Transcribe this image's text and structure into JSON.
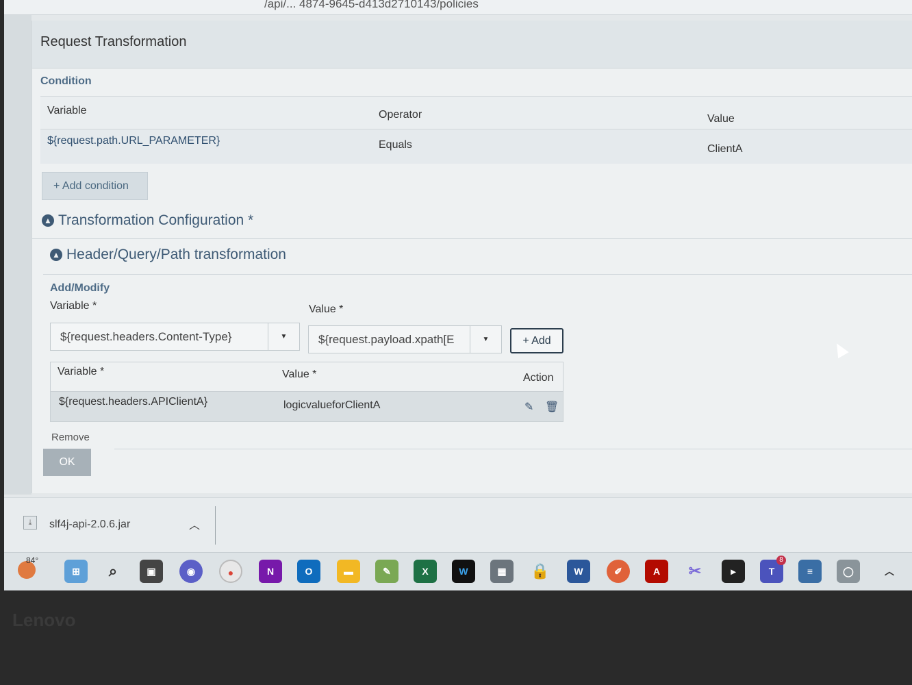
{
  "browser": {
    "url_fragment": "/api/... 4874-9645-d413d2710143/policies"
  },
  "modal": {
    "title": "Request Transformation",
    "condition": {
      "section_label": "Condition",
      "headers": [
        "Variable",
        "Operator",
        "Value"
      ],
      "row": {
        "variable": "${request.path.URL_PARAMETER}",
        "operator": "Equals",
        "value": "ClientA"
      },
      "add_condition_label": "+  Add condition"
    },
    "transformation_configuration_label": "Transformation Configuration *",
    "header_query_path_label": "Header/Query/Path transformation",
    "add_modify": {
      "section_label": "Add/Modify",
      "variable_label": "Variable *",
      "value_label": "Value *",
      "variable_select_value": "${request.headers.Content-Type}",
      "value_select_value": "${request.payload.xpath[E",
      "add_button_label": "+  Add"
    },
    "entries_table": {
      "headers": [
        "Variable *",
        "Value *",
        "Action"
      ],
      "rows": [
        {
          "variable": "${request.headers.APIClientA}",
          "value": "logicvalueforClientA"
        }
      ]
    },
    "remove_label": "Remove",
    "ok_button_label": "OK"
  },
  "download_bar": {
    "file_name": "slf4j-api-2.0.6.jar"
  },
  "taskbar": {
    "temperature": "84°",
    "teams_badge": "8",
    "icons": [
      "start-icon",
      "search-icon",
      "task-view-icon",
      "chat-icon",
      "chrome-icon",
      "onenote-icon",
      "outlook-icon",
      "file-explorer-icon",
      "notepad-plus-icon",
      "excel-icon",
      "webex-icon",
      "calculator-icon",
      "lock-icon",
      "word-icon",
      "pen-icon",
      "acrobat-icon",
      "snipping-tool-icon",
      "terminal-icon",
      "teams-icon",
      "notepad-icon",
      "app-icon"
    ]
  },
  "bezel": {
    "brand": "Lenovo"
  }
}
